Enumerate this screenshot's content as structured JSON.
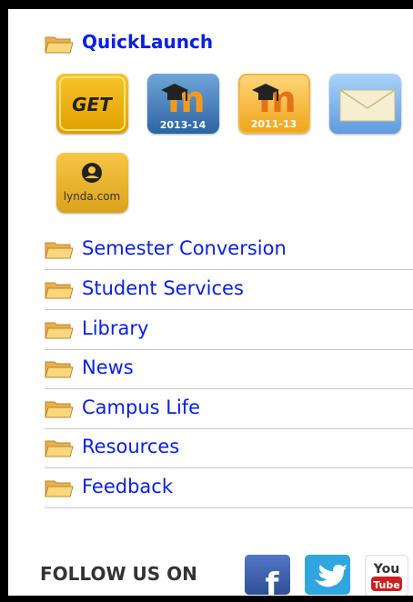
{
  "quicklaunch": {
    "title": "QuickLaunch",
    "tiles": [
      {
        "name": "get-tile",
        "label": "GET"
      },
      {
        "name": "moodle-2013-tile",
        "label": "2013-14"
      },
      {
        "name": "moodle-2011-tile",
        "label": "2011-13"
      },
      {
        "name": "email-tile",
        "label": ""
      },
      {
        "name": "lynda-tile",
        "label": "lynda.com"
      }
    ]
  },
  "nav": {
    "items": [
      {
        "label": "Semester Conversion"
      },
      {
        "label": "Student Services"
      },
      {
        "label": "Library"
      },
      {
        "label": "News"
      },
      {
        "label": "Campus Life"
      },
      {
        "label": "Resources"
      },
      {
        "label": "Feedback"
      }
    ]
  },
  "social": {
    "label": "FOLLOW US ON",
    "icons": [
      "facebook-icon",
      "twitter-icon",
      "youtube-icon"
    ]
  },
  "colors": {
    "link": "#0b20e0",
    "folder": "#f4c56c",
    "divider": "#c9c9c9",
    "frame": "#000000"
  }
}
